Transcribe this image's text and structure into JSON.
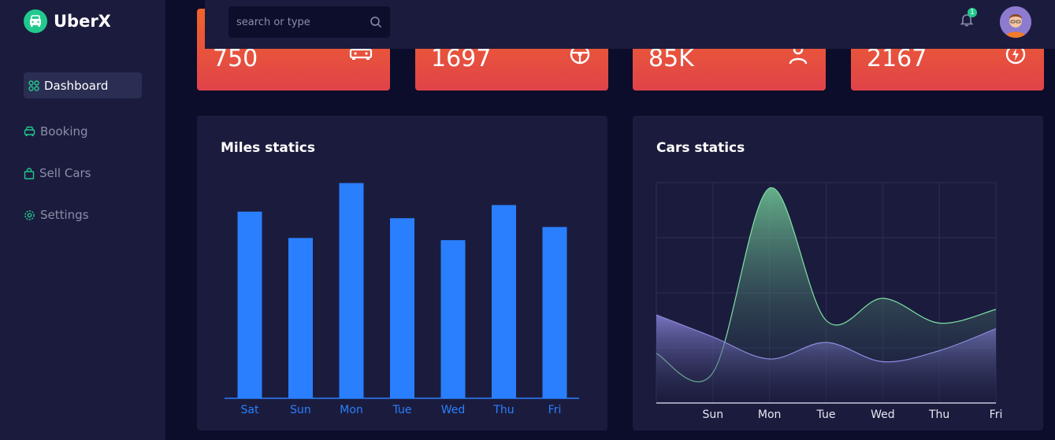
{
  "brand": {
    "name": "UberX",
    "accent": "#22c98e"
  },
  "sidebar": {
    "items": [
      {
        "label": "Dashboard",
        "icon": "dashboard-icon",
        "active": true
      },
      {
        "label": "Booking",
        "icon": "car-icon",
        "active": false
      },
      {
        "label": "Sell Cars",
        "icon": "bag-icon",
        "active": false
      },
      {
        "label": "Settings",
        "icon": "gear-icon",
        "active": false
      }
    ]
  },
  "topbar": {
    "search_placeholder": "search or type",
    "notification_count": "1"
  },
  "stats": [
    {
      "value": "750",
      "icon": "car-icon"
    },
    {
      "value": "1697",
      "icon": "steering-wheel-icon"
    },
    {
      "value": "85K",
      "icon": "person-icon"
    },
    {
      "value": "2167",
      "icon": "bolt-circle-icon"
    }
  ],
  "colors": {
    "bar": "#2a7fff",
    "green_series": "#7ee0a3",
    "purple_series": "#8e8be0",
    "stat_gradient_top": "#f0642c",
    "stat_gradient_bottom": "#e0434a"
  },
  "chart_data": [
    {
      "type": "bar",
      "title": "Miles statics",
      "categories": [
        "Sat",
        "Sun",
        "Mon",
        "Tue",
        "Wed",
        "Thu",
        "Fri"
      ],
      "values": [
        85,
        73,
        98,
        82,
        72,
        88,
        78
      ],
      "ylim": [
        0,
        100
      ],
      "grid": false
    },
    {
      "type": "area",
      "title": "Cars statics",
      "categories": [
        "",
        "Sun",
        "Mon",
        "Tue",
        "Wed",
        "Thu",
        "Fri"
      ],
      "series": [
        {
          "values": [
            90,
            55,
            390,
            150,
            190,
            145,
            170
          ]
        },
        {
          "values": [
            160,
            120,
            80,
            110,
            75,
            95,
            135
          ]
        }
      ],
      "ylim": [
        0,
        400
      ],
      "grid": true
    }
  ]
}
